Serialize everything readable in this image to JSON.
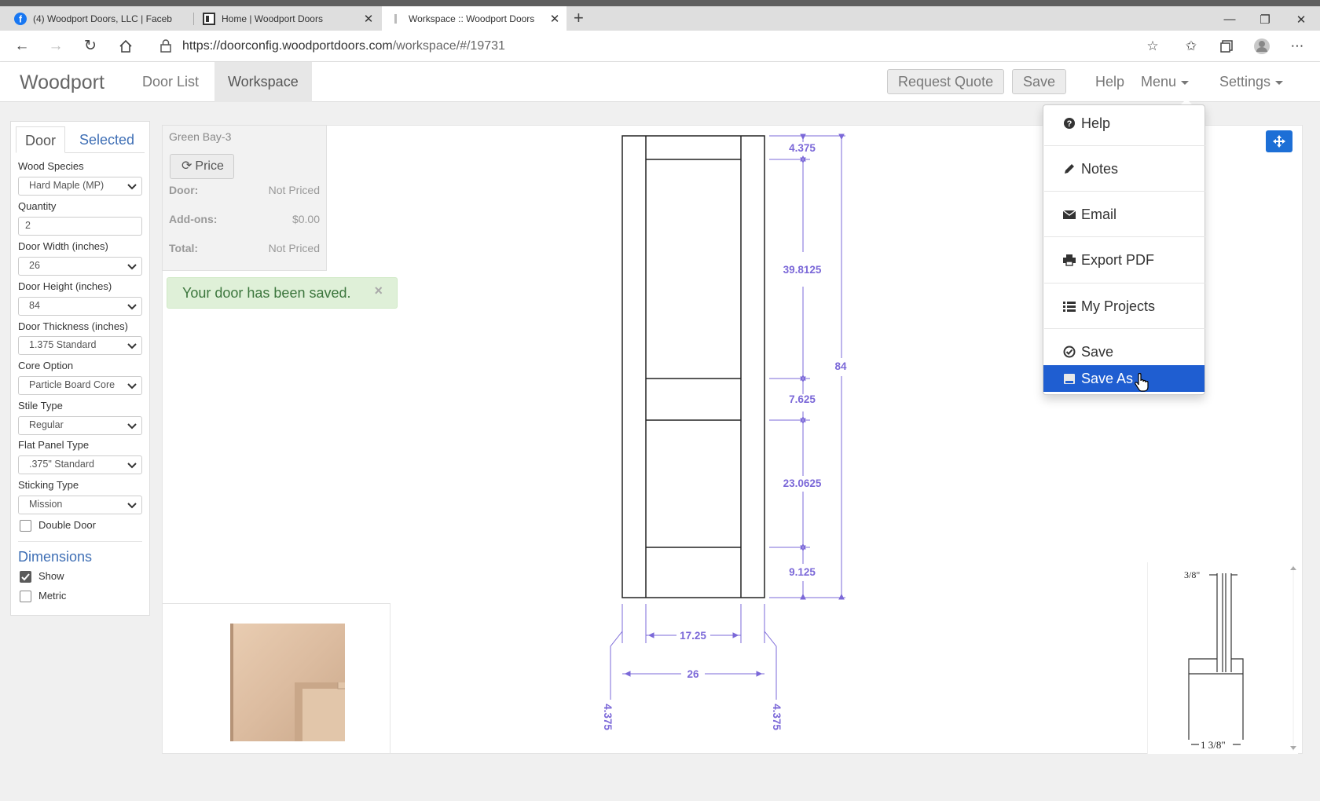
{
  "browser": {
    "tabs": [
      {
        "title": "(4) Woodport Doors, LLC | Faceb",
        "icon": "facebook-icon",
        "active": false
      },
      {
        "title": "Home | Woodport Doors",
        "icon": "page-icon",
        "active": false
      },
      {
        "title": "Workspace :: Woodport Doors",
        "icon": "loading-icon",
        "active": true
      }
    ],
    "new_tab": "+",
    "url_host": "https://doorconfig.woodportdoors.com",
    "url_path": "/workspace/#/19731"
  },
  "app": {
    "brand": "Woodport",
    "nav": {
      "door_list": "Door List",
      "workspace": "Workspace"
    },
    "right": {
      "request_quote": "Request Quote",
      "save": "Save",
      "help": "Help",
      "menu": "Menu",
      "settings": "Settings"
    }
  },
  "sidebar": {
    "tabs": {
      "door": "Door",
      "selected": "Selected"
    },
    "fields": {
      "wood_species": {
        "label": "Wood Species",
        "value": "Hard Maple (MP)"
      },
      "quantity": {
        "label": "Quantity",
        "value": "2"
      },
      "door_width": {
        "label": "Door Width (inches)",
        "value": "26"
      },
      "door_height": {
        "label": "Door Height (inches)",
        "value": "84"
      },
      "door_thickness": {
        "label": "Door Thickness (inches)",
        "value": "1.375 Standard"
      },
      "core_option": {
        "label": "Core Option",
        "value": "Particle Board Core"
      },
      "stile_type": {
        "label": "Stile Type",
        "value": "Regular"
      },
      "flat_panel_type": {
        "label": "Flat Panel Type",
        "value": ".375\" Standard"
      },
      "sticking_type": {
        "label": "Sticking Type",
        "value": "Mission"
      }
    },
    "double_door": {
      "label": "Double Door",
      "checked": false
    },
    "dimensions": {
      "title": "Dimensions",
      "show": {
        "label": "Show",
        "checked": true
      },
      "metric": {
        "label": "Metric",
        "checked": false
      }
    }
  },
  "pricing": {
    "title": "Green Bay-3",
    "price_button": "Price",
    "rows": [
      {
        "label": "Door:",
        "value": "Not Priced"
      },
      {
        "label": "Add-ons:",
        "value": "$0.00"
      },
      {
        "label": "Total:",
        "value": "Not Priced"
      }
    ]
  },
  "alert": {
    "message": "Your door has been saved.",
    "close": "×"
  },
  "drawing": {
    "vertical_dims": [
      "4.375",
      "39.8125",
      "7.625",
      "23.0625",
      "9.125"
    ],
    "overall_height": "84",
    "panel_width": "17.25",
    "overall_width": "26",
    "stile_left": "4.375",
    "stile_right": "4.375",
    "dim_color": "#7b68d8"
  },
  "profile_detail": {
    "top_label": "3/8\"",
    "bottom_label": "1 3/8\""
  },
  "menu_dropdown": {
    "items": [
      {
        "label": "Help",
        "icon": "question-circle-icon"
      },
      {
        "label": "Notes",
        "icon": "pencil-icon"
      },
      {
        "label": "Email",
        "icon": "envelope-icon"
      },
      {
        "label": "Export PDF",
        "icon": "printer-icon"
      },
      {
        "label": "My Projects",
        "icon": "list-icon"
      },
      {
        "label": "Save",
        "icon": "check-circle-icon"
      },
      {
        "label": "Save As",
        "icon": "save-as-icon",
        "highlighted": true
      }
    ],
    "highlight_color": "#1f5ed1"
  }
}
